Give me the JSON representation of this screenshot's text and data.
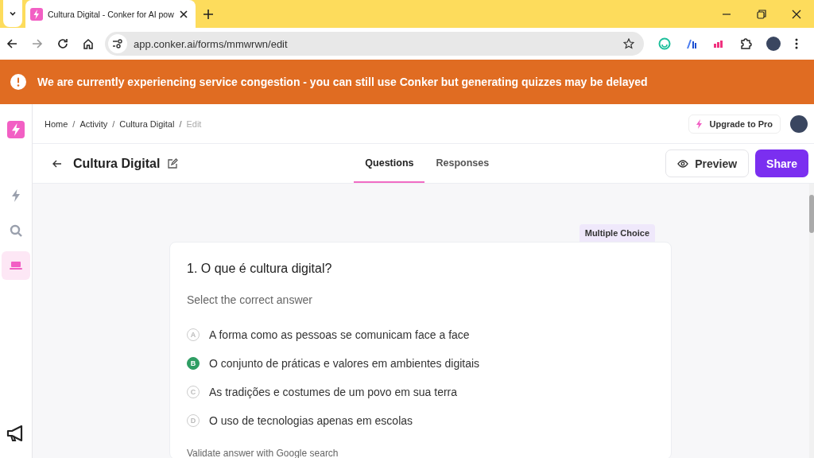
{
  "browser": {
    "tab_title": "Cultura Digital - Conker for AI pow",
    "url": "app.conker.ai/forms/mmwrwn/edit"
  },
  "banner": {
    "message": "We are currently experiencing service congestion - you can still use Conker but generating quizzes may be delayed"
  },
  "sidebar": {
    "items": [
      {
        "kind": "bolt",
        "selected": false
      },
      {
        "kind": "search",
        "selected": false
      },
      {
        "kind": "laptop",
        "selected": true
      }
    ]
  },
  "breadcrumbs": [
    {
      "label": "Home",
      "current": false
    },
    {
      "label": "Activity",
      "current": false
    },
    {
      "label": "Cultura Digital",
      "current": false
    },
    {
      "label": "Edit",
      "current": true
    }
  ],
  "breadcrumb_separator": "/",
  "upgrade_button": "Upgrade to Pro",
  "form_title": "Cultura Digital",
  "tabs": [
    {
      "label": "Questions",
      "selected": true
    },
    {
      "label": "Responses",
      "selected": false
    }
  ],
  "buttons": {
    "preview": "Preview",
    "share": "Share"
  },
  "question": {
    "type_tag": "Multiple Choice",
    "title": "1. O que é cultura digital?",
    "instruction": "Select the correct answer",
    "options": [
      {
        "letter": "A",
        "text": "A forma como as pessoas se comunicam face a face",
        "correct": false
      },
      {
        "letter": "B",
        "text": "O conjunto de práticas e valores em ambientes digitais",
        "correct": true
      },
      {
        "letter": "C",
        "text": "As tradições e costumes de um povo em sua terra",
        "correct": false
      },
      {
        "letter": "D",
        "text": "O uso de tecnologias apenas em escolas",
        "correct": false
      }
    ],
    "footer": "Validate answer with Google search"
  }
}
